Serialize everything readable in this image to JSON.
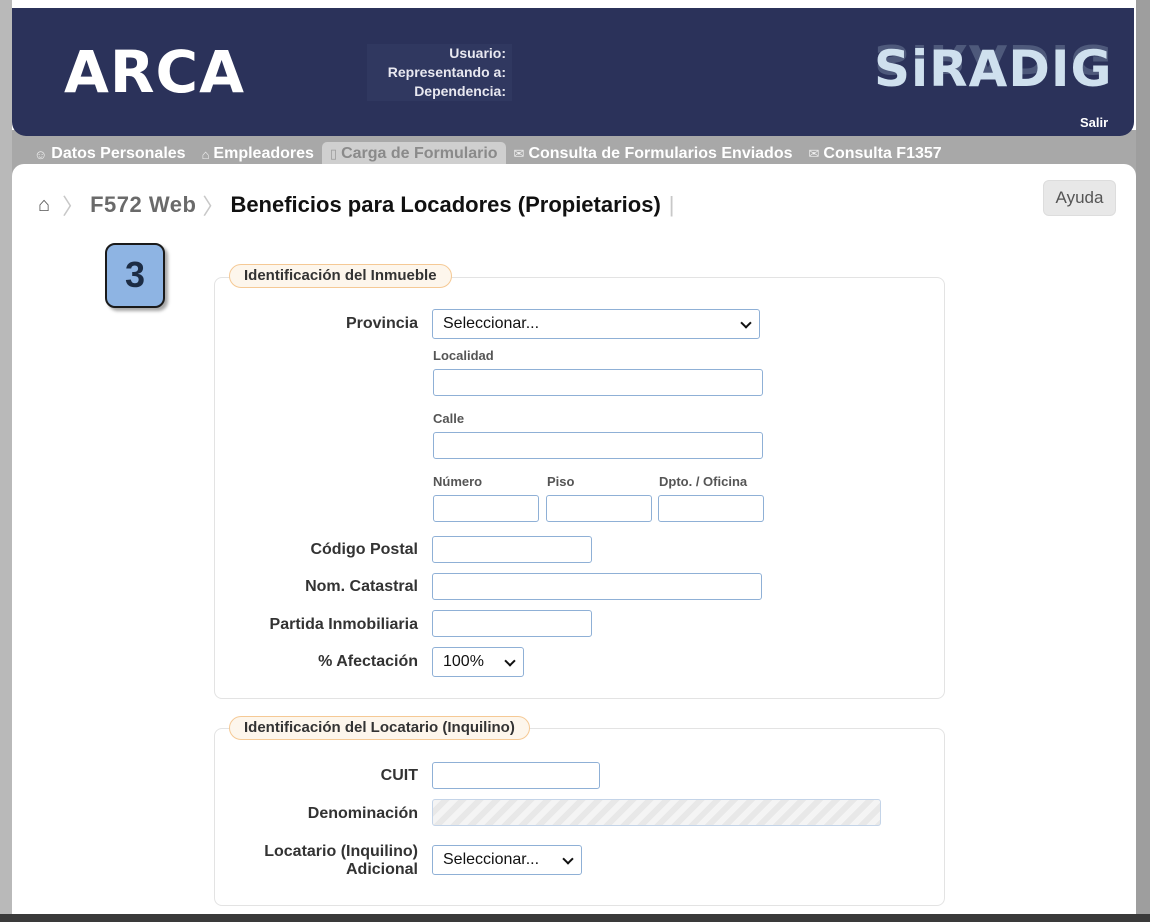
{
  "header": {
    "logo_left": "ARCA",
    "logo_right": "SiRADIG",
    "user_label": "Usuario:",
    "representing_label": "Representando a:",
    "dependency_label": "Dependencia:",
    "logout_label": "Salir"
  },
  "nav": {
    "items": [
      {
        "label": "Datos Personales",
        "icon": "person-icon"
      },
      {
        "label": "Empleadores",
        "icon": "building-icon"
      },
      {
        "label": "Carga de Formulario",
        "icon": "document-icon",
        "active": true
      },
      {
        "label": "Consulta de Formularios Enviados",
        "icon": "envelope-icon"
      },
      {
        "label": "Consulta F1357",
        "icon": "envelope-icon"
      }
    ]
  },
  "breadcrumb": {
    "home_icon": "home-icon",
    "form": "F572 Web",
    "title": "Beneficios para Locadores (Propietarios)"
  },
  "help_label": "Ayuda",
  "step_badge": "3",
  "inmueble": {
    "legend": "Identificación del Inmueble",
    "provincia_label": "Provincia",
    "provincia_value": "Seleccionar...",
    "localidad_label": "Localidad",
    "calle_label": "Calle",
    "numero_label": "Número",
    "piso_label": "Piso",
    "dpto_label": "Dpto. / Oficina",
    "codigo_postal_label": "Código Postal",
    "nom_catastral_label": "Nom. Catastral",
    "partida_label": "Partida Inmobiliaria",
    "afectacion_label": "% Afectación",
    "afectacion_value": "100%"
  },
  "locatario": {
    "legend": "Identificación del Locatario (Inquilino)",
    "cuit_label": "CUIT",
    "denominacion_label": "Denominación",
    "adicional_label_1": "Locatario (Inquilino)",
    "adicional_label_2": "Adicional",
    "adicional_value": "Seleccionar..."
  },
  "colors": {
    "header_bg": "#2b325a",
    "legend_border": "#f5c995",
    "input_border": "#8fb0d6",
    "badge_bg": "#8eb4e3"
  }
}
